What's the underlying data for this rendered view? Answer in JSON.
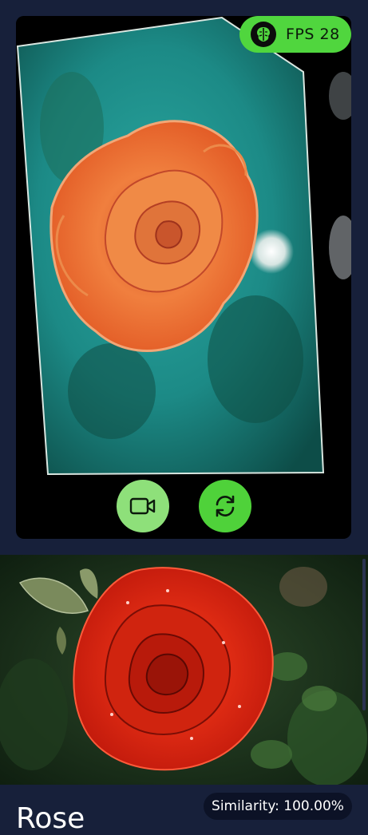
{
  "camera": {
    "fps_label": "FPS 28",
    "feed_subject": "orange rose on teal background"
  },
  "controls": {
    "video_icon": "video-camera-icon",
    "switch_icon": "switch-camera-icon"
  },
  "result": {
    "image_subject": "red rose with water droplets",
    "title": "Rose",
    "similarity": "Similarity: 100.00%"
  },
  "colors": {
    "background": "#17203a",
    "accent_green": "#50d63e",
    "light_green": "#8ee07a"
  }
}
